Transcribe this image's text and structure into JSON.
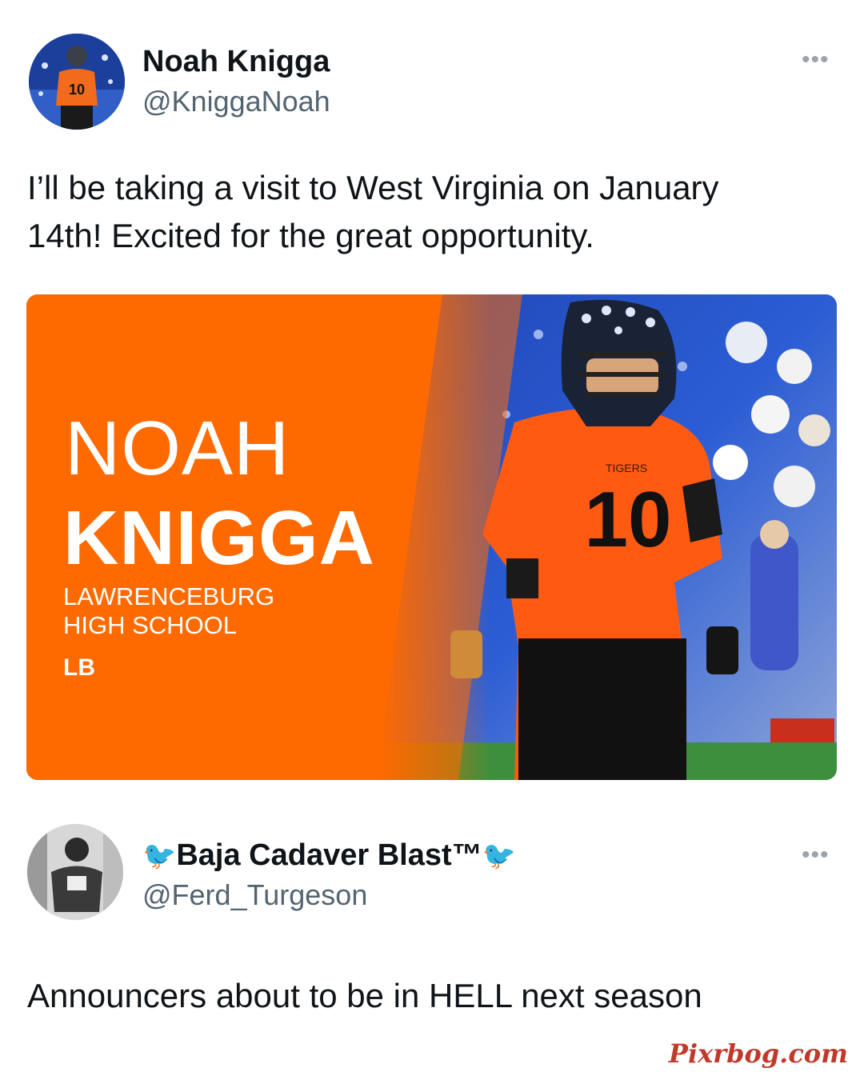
{
  "tweet1": {
    "display_name": "Noah Knigga",
    "handle": "@KniggaNoah",
    "more_icon": "more-horizontal-icon",
    "text_line1": "I’ll be taking a visit to West Virginia on January",
    "text_line2": "14th! Excited for the great opportunity.",
    "media": {
      "first_name": "NOAH",
      "last_name": "KNIGGA",
      "school_line1": "LAWRENCEBURG",
      "school_line2": "HIGH SCHOOL",
      "position": "LB",
      "jersey_team": "TIGERS",
      "jersey_number": "10",
      "accent_color": "#ff6a00"
    }
  },
  "tweet2": {
    "display_name": "Baja Cadaver Blast™",
    "handle": "@Ferd_Turgeson",
    "more_icon": "more-horizontal-icon",
    "text": "Announcers about to be in HELL next season"
  },
  "watermark": "Pixrbog.com"
}
